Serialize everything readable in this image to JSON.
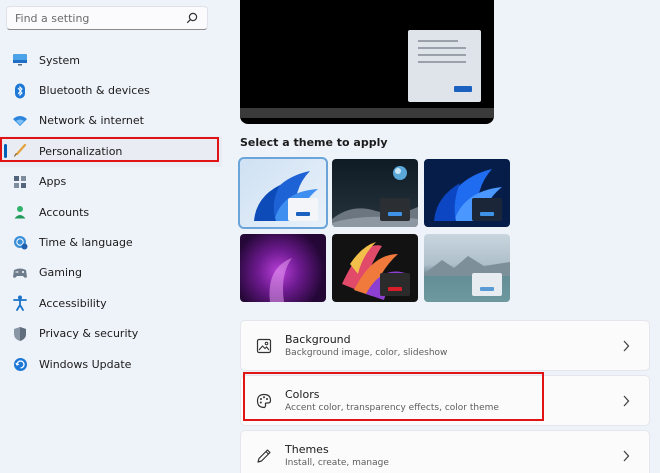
{
  "search": {
    "placeholder": "Find a setting"
  },
  "sidebar": {
    "items": [
      {
        "label": "System",
        "icon": "monitor-icon"
      },
      {
        "label": "Bluetooth & devices",
        "icon": "bluetooth-icon"
      },
      {
        "label": "Network & internet",
        "icon": "wifi-icon"
      },
      {
        "label": "Personalization",
        "icon": "paintbrush-icon",
        "active": true
      },
      {
        "label": "Apps",
        "icon": "apps-icon"
      },
      {
        "label": "Accounts",
        "icon": "person-icon"
      },
      {
        "label": "Time & language",
        "icon": "globe-clock-icon"
      },
      {
        "label": "Gaming",
        "icon": "gamepad-icon"
      },
      {
        "label": "Accessibility",
        "icon": "accessibility-icon"
      },
      {
        "label": "Privacy & security",
        "icon": "shield-icon"
      },
      {
        "label": "Windows Update",
        "icon": "update-icon"
      }
    ]
  },
  "main": {
    "section_title": "Select a theme to apply",
    "themes": [
      {
        "name": "windows-light",
        "selected": true
      },
      {
        "name": "windows-dark"
      },
      {
        "name": "windows-blue"
      },
      {
        "name": "glow"
      },
      {
        "name": "captured-motion"
      },
      {
        "name": "flow"
      }
    ],
    "cards": [
      {
        "title": "Background",
        "subtitle": "Background image, color, slideshow",
        "icon": "image-icon"
      },
      {
        "title": "Colors",
        "subtitle": "Accent color, transparency effects, color theme",
        "icon": "palette-icon"
      },
      {
        "title": "Themes",
        "subtitle": "Install, create, manage",
        "icon": "pen-icon"
      }
    ]
  },
  "colors": {
    "accent": "#005fb8",
    "highlight": "#e01414",
    "background": "#eef2f9"
  }
}
